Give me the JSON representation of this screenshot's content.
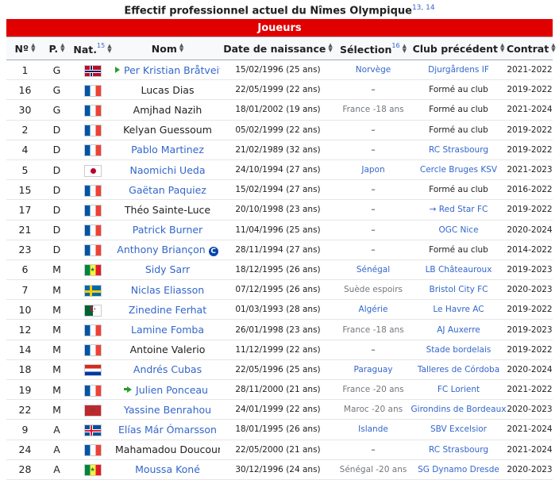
{
  "caption": {
    "title": "Effectif professionnel actuel du Nîmes Olympique",
    "refs": "13, 14"
  },
  "section_label": "Joueurs",
  "columns": {
    "num": "Nº",
    "pos": "P.",
    "nat": "Nat.",
    "nat_ref": "15",
    "nom": "Nom",
    "date": "Date de naissance",
    "sel": "Sélection",
    "sel_ref": "16",
    "club": "Club précédent",
    "ctr": "Contrat"
  },
  "players": [
    {
      "num": "1",
      "pos": "G",
      "flag": "nor",
      "name": "Per Kristian Bråtveit",
      "arrow": true,
      "captain": false,
      "name_link": true,
      "dob": "15/02/1996 (25 ans)",
      "sel": "Norvège",
      "sel_link": true,
      "club": "Djurgårdens IF",
      "club_link": true,
      "contract": "2021-2022"
    },
    {
      "num": "16",
      "pos": "G",
      "flag": "fra",
      "name": "Lucas Dias",
      "arrow": false,
      "captain": false,
      "name_link": false,
      "dob": "22/05/1999 (22 ans)",
      "sel": "–",
      "sel_link": false,
      "club": "Formé au club",
      "club_link": false,
      "contract": "2019-2022"
    },
    {
      "num": "30",
      "pos": "G",
      "flag": "fra",
      "name": "Amjhad Nazih",
      "arrow": false,
      "captain": false,
      "name_link": false,
      "dob": "18/01/2002 (19 ans)",
      "sel": "France -18 ans",
      "sel_link": false,
      "sel_grey": true,
      "club": "Formé au club",
      "club_link": false,
      "contract": "2021-2024"
    },
    {
      "num": "2",
      "pos": "D",
      "flag": "fra",
      "name": "Kelyan Guessoum",
      "arrow": false,
      "captain": false,
      "name_link": false,
      "dob": "05/02/1999 (22 ans)",
      "sel": "–",
      "sel_link": false,
      "club": "Formé au club",
      "club_link": false,
      "contract": "2019-2022"
    },
    {
      "num": "4",
      "pos": "D",
      "flag": "fra",
      "name": "Pablo Martinez",
      "arrow": false,
      "captain": false,
      "name_link": true,
      "dob": "21/02/1989 (32 ans)",
      "sel": "–",
      "sel_link": false,
      "club": "RC Strasbourg",
      "club_link": true,
      "contract": "2019-2022"
    },
    {
      "num": "5",
      "pos": "D",
      "flag": "jpn",
      "name": "Naomichi Ueda",
      "arrow": false,
      "captain": false,
      "name_link": true,
      "dob": "24/10/1994 (27 ans)",
      "sel": "Japon",
      "sel_link": true,
      "club": "Cercle Bruges KSV",
      "club_link": true,
      "contract": "2021-2023"
    },
    {
      "num": "15",
      "pos": "D",
      "flag": "fra",
      "name": "Gaëtan Paquiez",
      "arrow": false,
      "captain": false,
      "name_link": true,
      "dob": "15/02/1994 (27 ans)",
      "sel": "–",
      "sel_link": false,
      "club": "Formé au club",
      "club_link": false,
      "contract": "2016-2022"
    },
    {
      "num": "17",
      "pos": "D",
      "flag": "fra",
      "name": "Théo Sainte-Luce",
      "arrow": false,
      "captain": false,
      "name_link": false,
      "dob": "20/10/1998 (23 ans)",
      "sel": "–",
      "sel_link": false,
      "club": "→ Red Star FC",
      "club_link": true,
      "contract": "2019-2022"
    },
    {
      "num": "21",
      "pos": "D",
      "flag": "fra",
      "name": "Patrick Burner",
      "arrow": false,
      "captain": false,
      "name_link": true,
      "dob": "11/04/1996 (25 ans)",
      "sel": "–",
      "sel_link": false,
      "club": "OGC Nice",
      "club_link": true,
      "contract": "2020-2024"
    },
    {
      "num": "23",
      "pos": "D",
      "flag": "fra",
      "name": "Anthony Briançon",
      "arrow": false,
      "captain": true,
      "name_link": true,
      "dob": "28/11/1994 (27 ans)",
      "sel": "–",
      "sel_link": false,
      "club": "Formé au club",
      "club_link": false,
      "contract": "2014-2022"
    },
    {
      "num": "6",
      "pos": "M",
      "flag": "sen",
      "name": "Sidy Sarr",
      "arrow": false,
      "captain": false,
      "name_link": true,
      "dob": "18/12/1995 (26 ans)",
      "sel": "Sénégal",
      "sel_link": true,
      "club": "LB Châteauroux",
      "club_link": true,
      "contract": "2019-2023"
    },
    {
      "num": "7",
      "pos": "M",
      "flag": "swe",
      "name": "Niclas Eliasson",
      "arrow": false,
      "captain": false,
      "name_link": true,
      "dob": "07/12/1995 (26 ans)",
      "sel": "Suède espoirs",
      "sel_link": false,
      "sel_grey": true,
      "club": "Bristol City FC",
      "club_link": true,
      "contract": "2020-2023"
    },
    {
      "num": "10",
      "pos": "M",
      "flag": "alg",
      "name": "Zinedine Ferhat",
      "arrow": false,
      "captain": false,
      "name_link": true,
      "dob": "01/03/1993 (28 ans)",
      "sel": "Algérie",
      "sel_link": true,
      "club": "Le Havre AC",
      "club_link": true,
      "contract": "2019-2022"
    },
    {
      "num": "12",
      "pos": "M",
      "flag": "fra",
      "name": "Lamine Fomba",
      "arrow": false,
      "captain": false,
      "name_link": true,
      "dob": "26/01/1998 (23 ans)",
      "sel": "France -18 ans",
      "sel_link": false,
      "sel_grey": true,
      "club": "AJ Auxerre",
      "club_link": true,
      "contract": "2019-2023"
    },
    {
      "num": "14",
      "pos": "M",
      "flag": "fra",
      "name": "Antoine Valerio",
      "arrow": false,
      "captain": false,
      "name_link": false,
      "dob": "11/12/1999 (22 ans)",
      "sel": "–",
      "sel_link": false,
      "club": "Stade bordelais",
      "club_link": true,
      "contract": "2019-2022"
    },
    {
      "num": "18",
      "pos": "M",
      "flag": "par",
      "name": "Andrés Cubas",
      "arrow": false,
      "captain": false,
      "name_link": true,
      "dob": "22/05/1996 (25 ans)",
      "sel": "Paraguay",
      "sel_link": true,
      "club": "Talleres de Córdoba",
      "club_link": true,
      "contract": "2020-2024"
    },
    {
      "num": "19",
      "pos": "M",
      "flag": "fra",
      "name": "Julien Ponceau",
      "arrow": true,
      "captain": false,
      "name_link": true,
      "dob": "28/11/2000 (21 ans)",
      "sel": "France -20 ans",
      "sel_link": false,
      "sel_grey": true,
      "club": "FC Lorient",
      "club_link": true,
      "contract": "2021-2022"
    },
    {
      "num": "22",
      "pos": "M",
      "flag": "mar",
      "name": "Yassine Benrahou",
      "arrow": false,
      "captain": false,
      "name_link": true,
      "dob": "24/01/1999 (22 ans)",
      "sel": "Maroc -20 ans",
      "sel_link": false,
      "sel_grey": true,
      "club": "Girondins de Bordeaux",
      "club_link": true,
      "contract": "2020-2023"
    },
    {
      "num": "9",
      "pos": "A",
      "flag": "isl",
      "name": "Elías Már Ómarsson",
      "arrow": false,
      "captain": false,
      "name_link": true,
      "dob": "18/01/1995 (26 ans)",
      "sel": "Islande",
      "sel_link": true,
      "club": "SBV Excelsior",
      "club_link": true,
      "contract": "2021-2024"
    },
    {
      "num": "24",
      "pos": "A",
      "flag": "fra",
      "name": "Mahamadou Doucouré",
      "arrow": false,
      "captain": false,
      "name_link": false,
      "dob": "22/05/2000 (21 ans)",
      "sel": "–",
      "sel_link": false,
      "club": "RC Strasbourg",
      "club_link": true,
      "contract": "2021-2024"
    },
    {
      "num": "28",
      "pos": "A",
      "flag": "sen",
      "name": "Moussa Koné",
      "arrow": false,
      "captain": false,
      "name_link": true,
      "dob": "30/12/1996 (24 ans)",
      "sel": "Sénégal -20 ans",
      "sel_link": false,
      "sel_grey": true,
      "club": "SG Dynamo Dresde",
      "club_link": true,
      "contract": "2020-2023"
    }
  ]
}
